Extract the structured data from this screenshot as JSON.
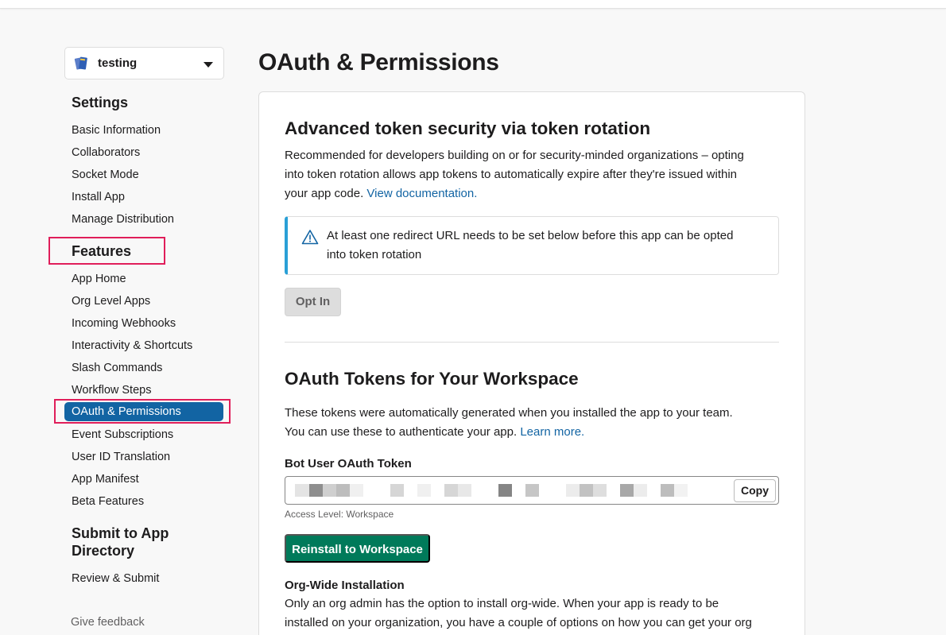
{
  "app_selector": {
    "name": "testing",
    "icon": "app-notebook-icon"
  },
  "sidebar": {
    "settings_heading": "Settings",
    "settings_items": [
      "Basic Information",
      "Collaborators",
      "Socket Mode",
      "Install App",
      "Manage Distribution"
    ],
    "features_heading": "Features",
    "features_items": [
      "App Home",
      "Org Level Apps",
      "Incoming Webhooks",
      "Interactivity & Shortcuts",
      "Slash Commands",
      "Workflow Steps",
      "OAuth & Permissions",
      "Event Subscriptions",
      "User ID Translation",
      "App Manifest",
      "Beta Features"
    ],
    "active_item": "OAuth & Permissions",
    "submit_heading_line1": "Submit to App",
    "submit_heading_line2": "Directory",
    "submit_items": [
      "Review & Submit"
    ],
    "feedback": "Give feedback"
  },
  "main": {
    "page_title": "OAuth & Permissions",
    "token_rotation": {
      "title": "Advanced token security via token rotation",
      "description_line1": "Recommended for developers building on or for security-minded organizations – opting",
      "description_line2": "into token rotation allows app tokens to automatically expire after they're issued within",
      "description_line3": "your app code.",
      "doc_link": "View documentation.",
      "notice_line1": "At least one redirect URL needs to be set below before this app can be opted",
      "notice_line2": "into token rotation",
      "opt_in_label": "Opt In"
    },
    "oauth_tokens": {
      "title": "OAuth Tokens for Your Workspace",
      "description_line1": "These tokens were automatically generated when you installed the app to your team.",
      "description_line2": "You can use these to authenticate your app.",
      "learn_more": "Learn more.",
      "bot_token_label": "Bot User OAuth Token",
      "copy_label": "Copy",
      "access_level": "Access Level: Workspace",
      "reinstall_label": "Reinstall to Workspace",
      "org_wide_title": "Org-Wide Installation",
      "org_wide_line1": "Only an org admin has the option to install org-wide. When your app is ready to be",
      "org_wide_line2": "installed on your organization, you have a couple of options on how you can get your org"
    }
  },
  "colors": {
    "accent": "#1264a3",
    "green": "#007a5a",
    "highlight": "#e01e5a",
    "notice_border": "#2aa0d6"
  }
}
